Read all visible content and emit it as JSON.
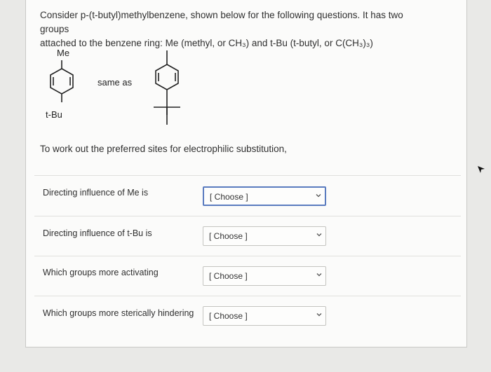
{
  "question": {
    "line1": "Consider p-(t-butyl)methylbenzene, shown below for the following questions. It has two groups",
    "line2": "attached to the benzene ring: Me (methyl, or CH₃) and t-Bu (t-butyl, or C(CH₃)₃)"
  },
  "molecule": {
    "me_label": "Me",
    "tbu_label": "t-Bu",
    "same_as": "same as"
  },
  "intro": "To work out the preferred sites for electrophilic substitution,",
  "rows": [
    {
      "label": "Directing influence of Me is",
      "select": "[ Choose ]"
    },
    {
      "label": "Directing influence of t-Bu is",
      "select": "[ Choose ]"
    },
    {
      "label": "Which groups more activating",
      "select": "[ Choose ]"
    },
    {
      "label": "Which groups more sterically hindering",
      "select": "[ Choose ]"
    }
  ],
  "colors": {
    "active_border": "#5a7bbf"
  }
}
